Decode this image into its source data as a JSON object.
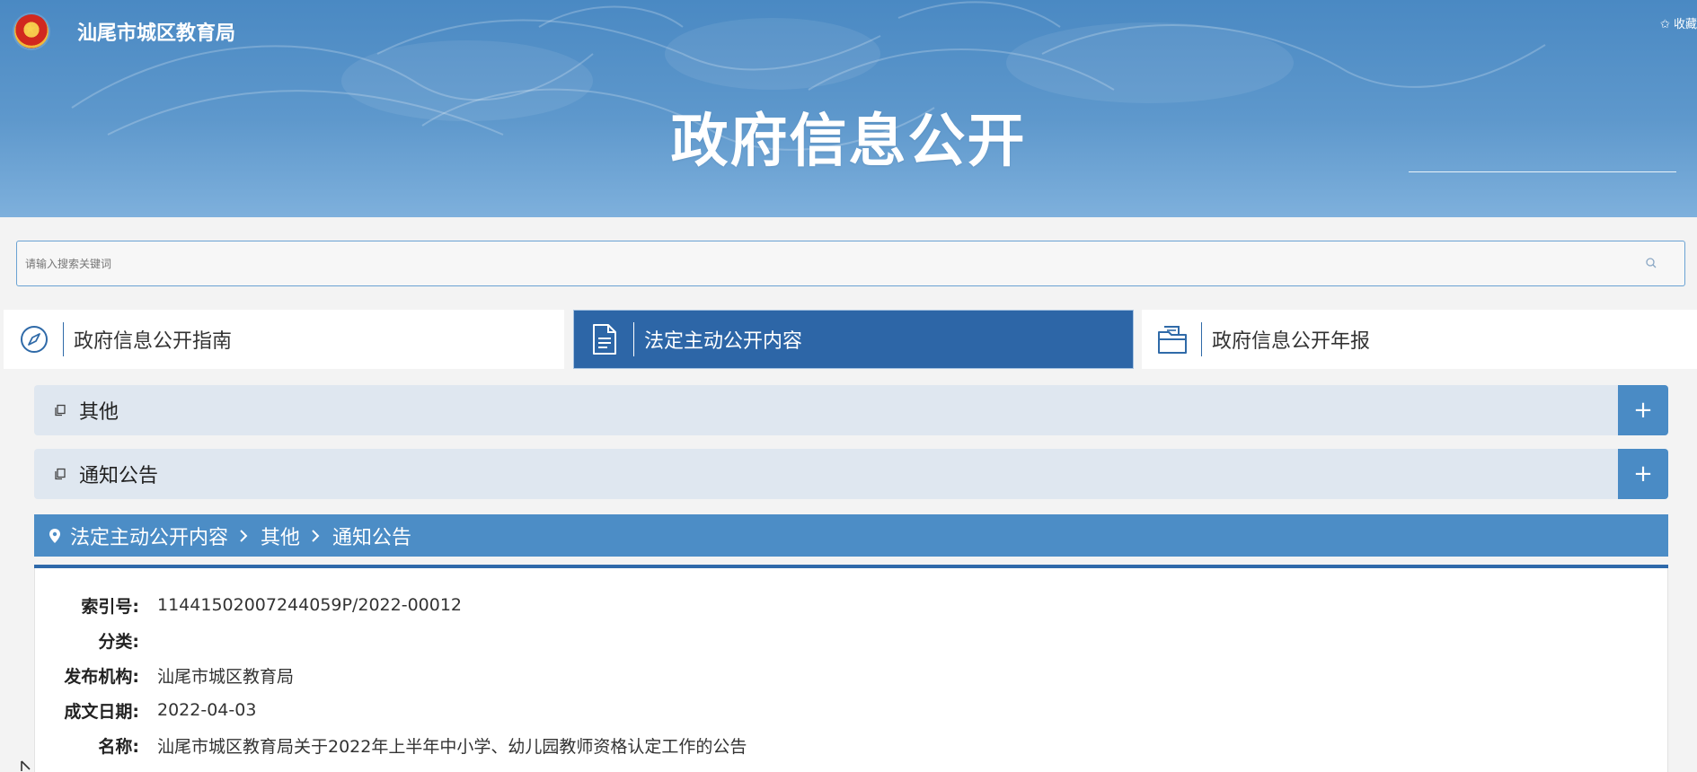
{
  "header": {
    "site_name": "汕尾市城区教育局",
    "favorite": "✩ 收藏",
    "title": "政府信息公开"
  },
  "search": {
    "placeholder": "请输入搜索关键词"
  },
  "tabs": [
    {
      "label": "政府信息公开指南",
      "icon": "compass-icon",
      "active": false
    },
    {
      "label": "法定主动公开内容",
      "icon": "document-icon",
      "active": true
    },
    {
      "label": "政府信息公开年报",
      "icon": "folder-icon",
      "active": false
    }
  ],
  "accordions": [
    {
      "label": "其他",
      "toggle": "+"
    },
    {
      "label": "通知公告",
      "toggle": "+"
    }
  ],
  "breadcrumb": [
    "法定主动公开内容",
    "其他",
    "通知公告"
  ],
  "details": [
    {
      "key": "索引号:",
      "value": "11441502007244059P/2022-00012"
    },
    {
      "key": "分类:",
      "value": ""
    },
    {
      "key": "发布机构:",
      "value": "汕尾市城区教育局"
    },
    {
      "key": "成文日期:",
      "value": "2022-04-03"
    },
    {
      "key": "名称:",
      "value": "汕尾市城区教育局关于2022年上半年中小学、幼儿园教师资格认定工作的公告"
    }
  ],
  "colors": {
    "banner": "#4a89c3",
    "active_tab": "#2d66a7",
    "accordion_bg": "#dfe7f0",
    "accordion_toggle": "#4a8bc5",
    "breadcrumb_bar": "#4c8dc6"
  }
}
